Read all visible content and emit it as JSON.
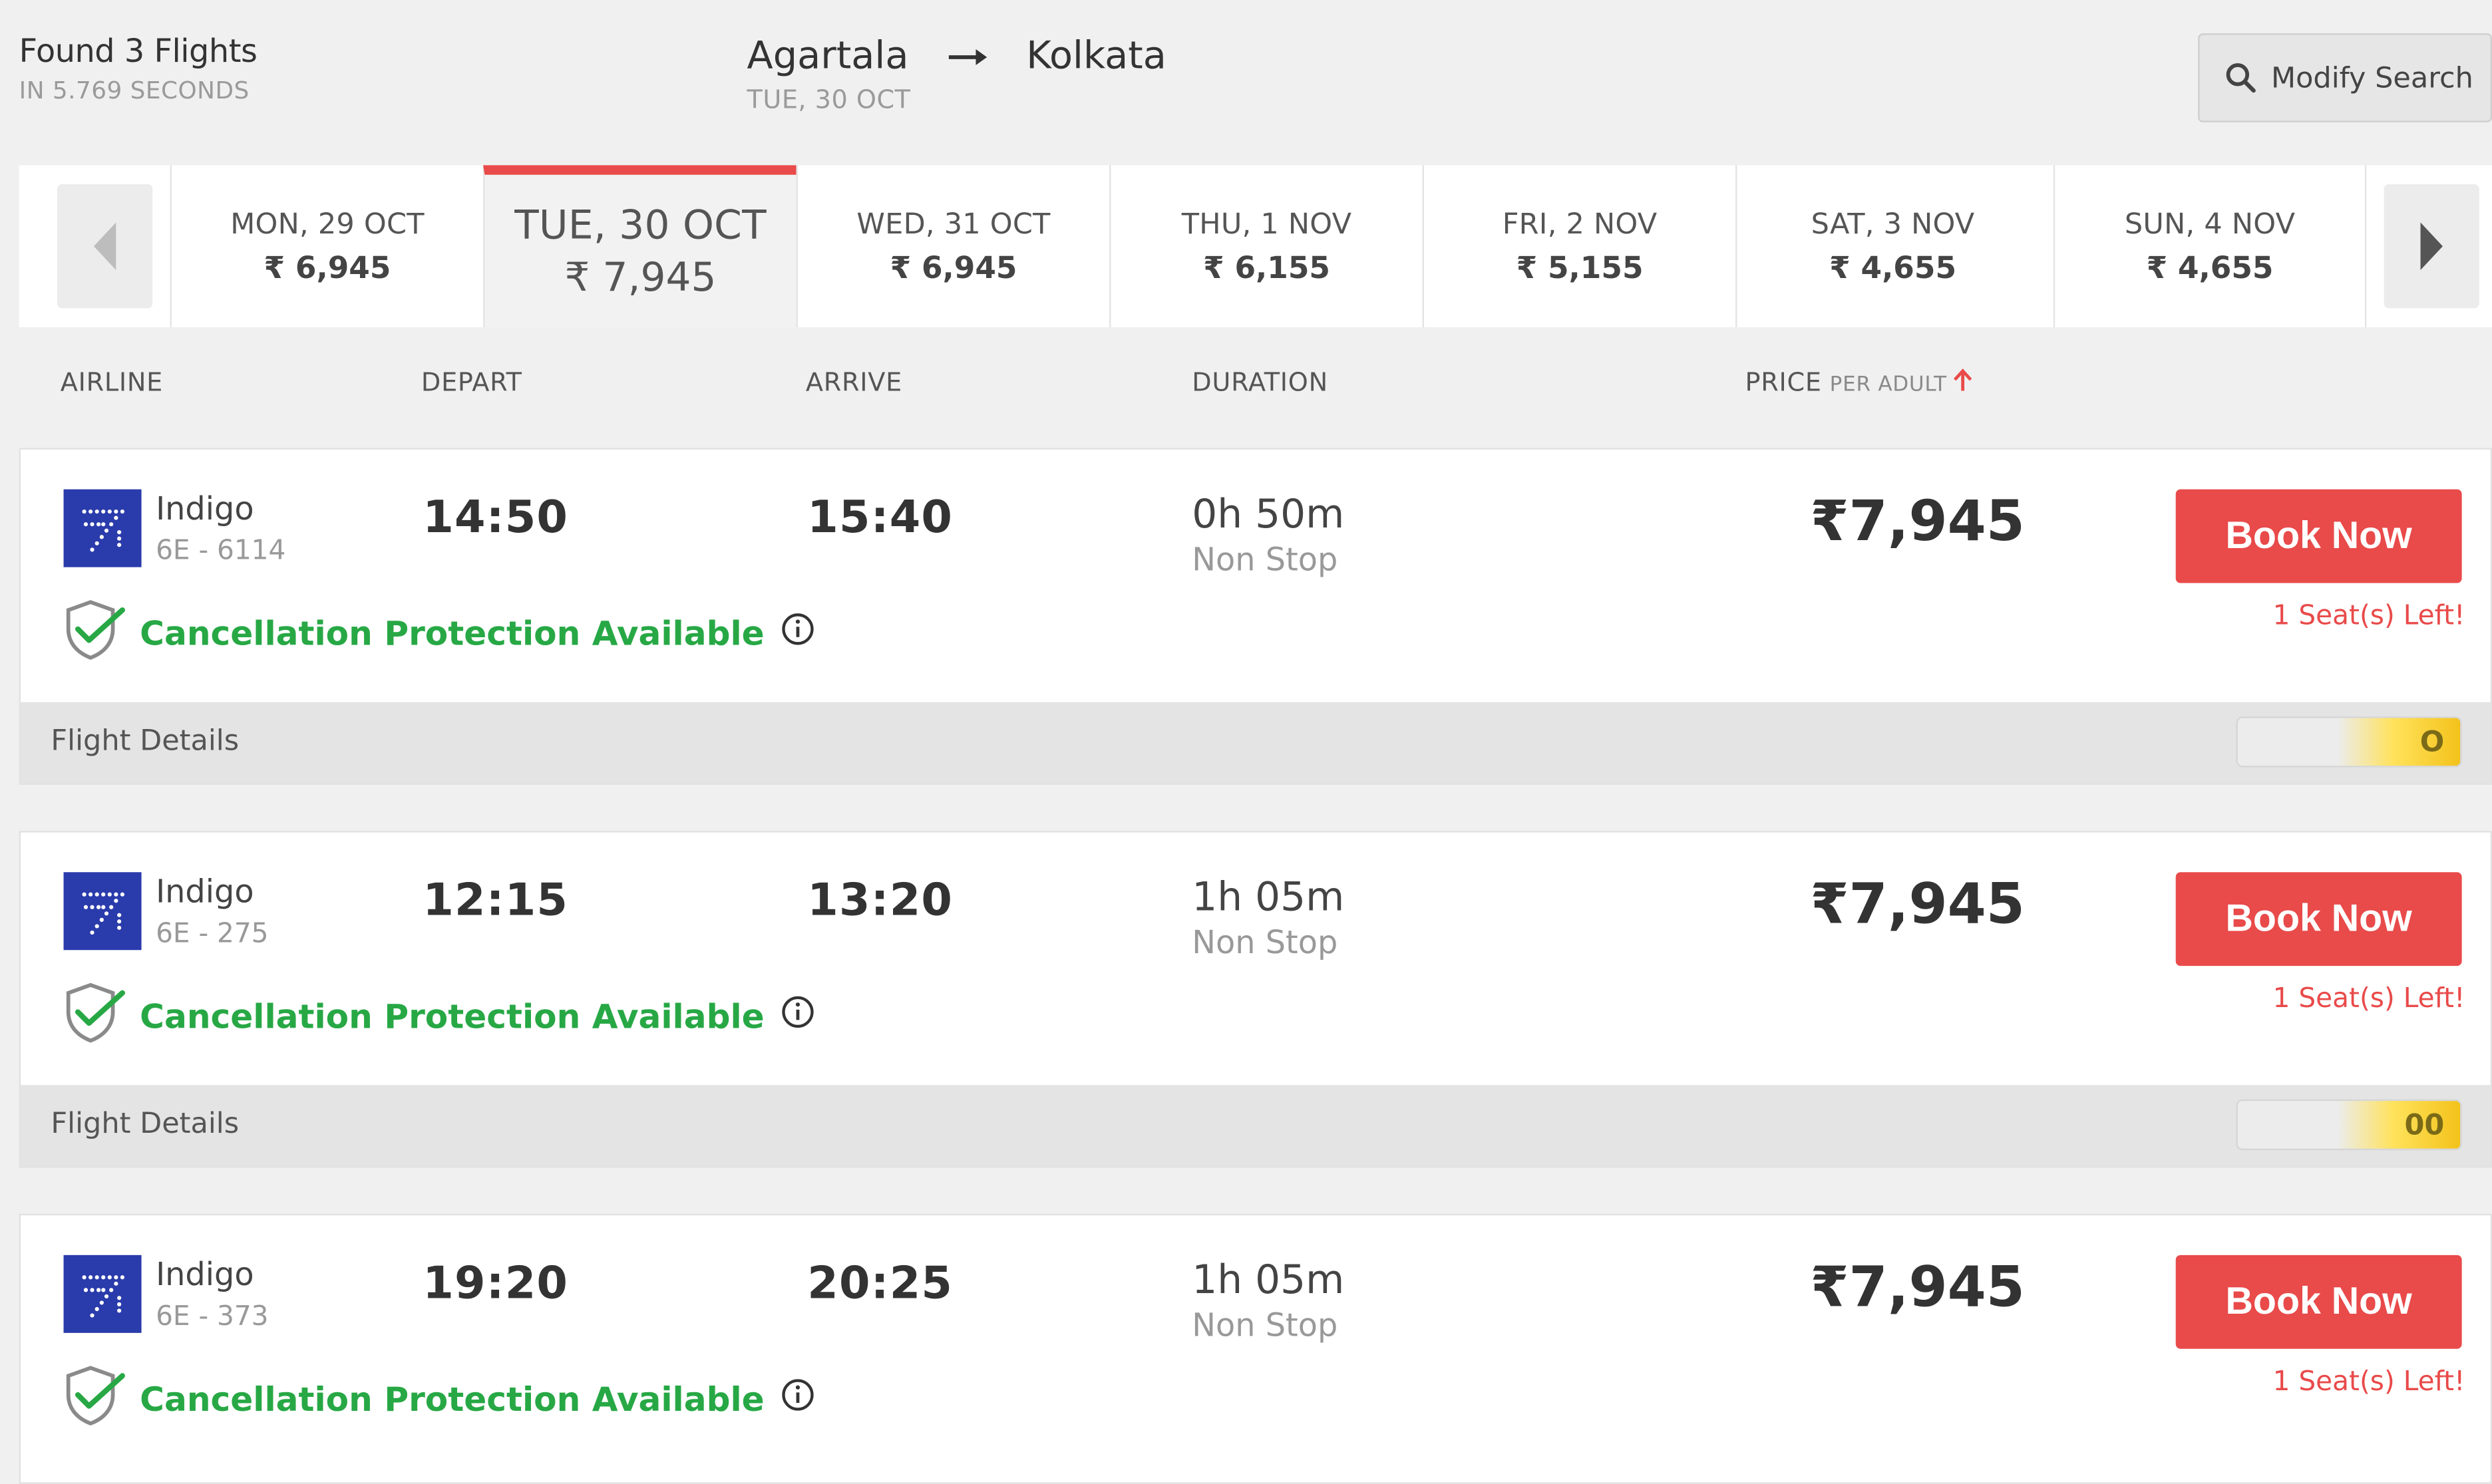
{
  "header": {
    "found_title": "Found 3 Flights",
    "found_sub": "IN 5.769 SECONDS",
    "origin": "Agartala",
    "destination": "Kolkata",
    "route_date": "TUE, 30 OCT",
    "modify_label": "Modify Search"
  },
  "dates": [
    {
      "label": "MON, 29 OCT",
      "price": "₹ 6,945"
    },
    {
      "label": "TUE, 30 OCT",
      "price": "₹ 7,945",
      "active": true
    },
    {
      "label": "WED, 31 OCT",
      "price": "₹ 6,945"
    },
    {
      "label": "THU, 1 NOV",
      "price": "₹ 6,155"
    },
    {
      "label": "FRI, 2 NOV",
      "price": "₹ 5,155"
    },
    {
      "label": "SAT, 3 NOV",
      "price": "₹ 4,655"
    },
    {
      "label": "SUN, 4 NOV",
      "price": "₹ 4,655"
    }
  ],
  "columns": {
    "airline": "AIRLINE",
    "depart": "DEPART",
    "arrive": "ARRIVE",
    "duration": "DURATION",
    "price": "PRICE",
    "price_sub": "PER ADULT"
  },
  "flights": [
    {
      "airline": "Indigo",
      "flight_no": "6E - 6114",
      "depart": "14:50",
      "arrive": "15:40",
      "duration": "0h 50m",
      "stops": "Non Stop",
      "price": "₹7,945",
      "book_label": "Book Now",
      "seats": "1 Seat(s) Left!",
      "cancel_text": "Cancellation Protection Available",
      "details_label": "Flight Details",
      "promo": "O"
    },
    {
      "airline": "Indigo",
      "flight_no": "6E - 275",
      "depart": "12:15",
      "arrive": "13:20",
      "duration": "1h 05m",
      "stops": "Non Stop",
      "price": "₹7,945",
      "book_label": "Book Now",
      "seats": "1 Seat(s) Left!",
      "cancel_text": "Cancellation Protection Available",
      "details_label": "Flight Details",
      "promo": "00"
    },
    {
      "airline": "Indigo",
      "flight_no": "6E - 373",
      "depart": "19:20",
      "arrive": "20:25",
      "duration": "1h 05m",
      "stops": "Non Stop",
      "price": "₹7,945",
      "book_label": "Book Now",
      "seats": "1 Seat(s) Left!",
      "cancel_text": "Cancellation Protection Available"
    }
  ],
  "colors": {
    "accent_red": "#e94a4a",
    "green": "#27a845",
    "indigo_blue": "#2a3bab",
    "background": "#f0f0f0"
  },
  "icons": {
    "search": "search-icon",
    "route_arrow": "arrow-right-icon",
    "prev": "chevron-left-icon",
    "next": "chevron-right-icon",
    "sort": "arrow-up-icon",
    "shield": "shield-check-icon",
    "info": "info-icon",
    "airline_logo": "indigo-logo-icon"
  }
}
